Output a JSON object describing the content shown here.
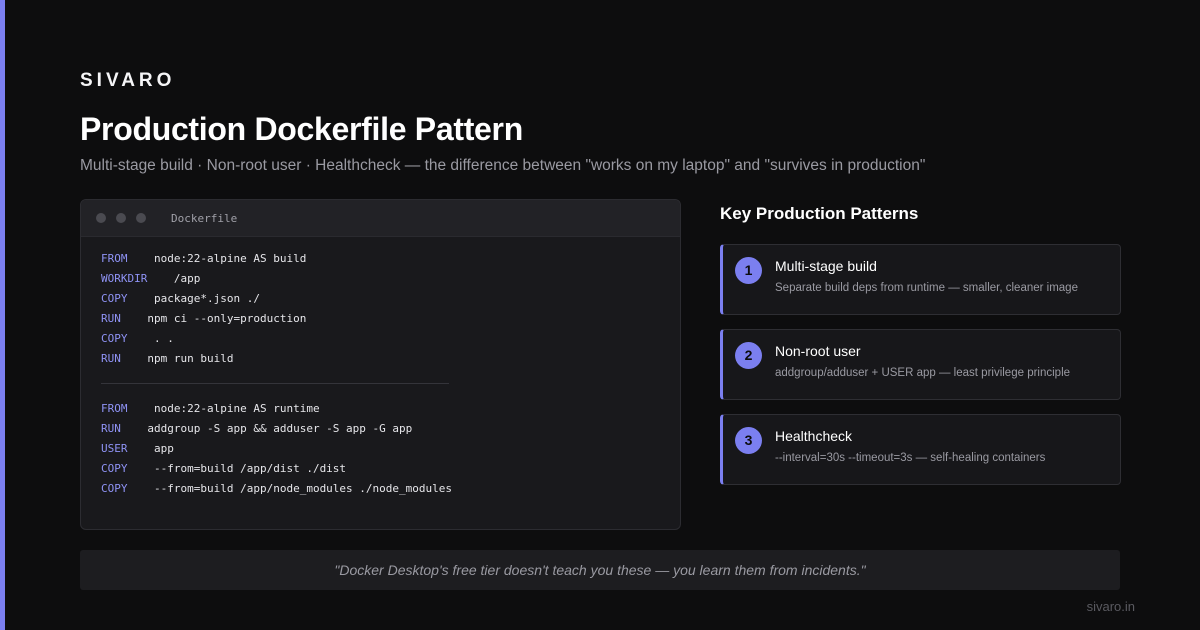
{
  "brand": "SIVARO",
  "title": "Production Dockerfile Pattern",
  "subtitle": "Multi-stage build · Non-root user · Healthcheck — the difference between \"works on my laptop\" and \"survives in production\"",
  "colors": {
    "accent": "#7b7ff0",
    "background": "#0d0d0e",
    "keyword": "#8f93f5"
  },
  "code_window": {
    "filename": "Dockerfile",
    "build_stage": [
      {
        "kw": "FROM",
        "pad": "    ",
        "arg": "node:22-alpine AS build"
      },
      {
        "kw": "WORKDIR",
        "pad": "    ",
        "arg": "/app"
      },
      {
        "kw": "COPY",
        "pad": "    ",
        "arg": "package*.json ./"
      },
      {
        "kw": "RUN",
        "pad": "    ",
        "arg": "npm ci --only=production"
      },
      {
        "kw": "COPY",
        "pad": "    ",
        "arg": ". ."
      },
      {
        "kw": "RUN",
        "pad": "    ",
        "arg": "npm run build"
      }
    ],
    "runtime_stage": [
      {
        "kw": "FROM",
        "pad": "    ",
        "arg": "node:22-alpine AS runtime"
      },
      {
        "kw": "RUN",
        "pad": "    ",
        "arg": "addgroup -S app && adduser -S app -G app"
      },
      {
        "kw": "USER",
        "pad": "    ",
        "arg": "app"
      },
      {
        "kw": "COPY",
        "pad": "    ",
        "arg": "--from=build /app/dist ./dist"
      },
      {
        "kw": "COPY",
        "pad": "    ",
        "arg": "--from=build /app/node_modules ./node_modules"
      }
    ]
  },
  "patterns": {
    "heading": "Key Production Patterns",
    "items": [
      {
        "number": "1",
        "title": "Multi-stage build",
        "desc": "Separate build deps from runtime — smaller, cleaner image"
      },
      {
        "number": "2",
        "title": "Non-root user",
        "desc": "addgroup/adduser + USER app — least privilege principle"
      },
      {
        "number": "3",
        "title": "Healthcheck",
        "desc": "--interval=30s --timeout=3s — self-healing containers"
      }
    ]
  },
  "quote": "\"Docker Desktop's free tier doesn't teach you these — you learn them from incidents.\"",
  "site": "sivaro.in"
}
